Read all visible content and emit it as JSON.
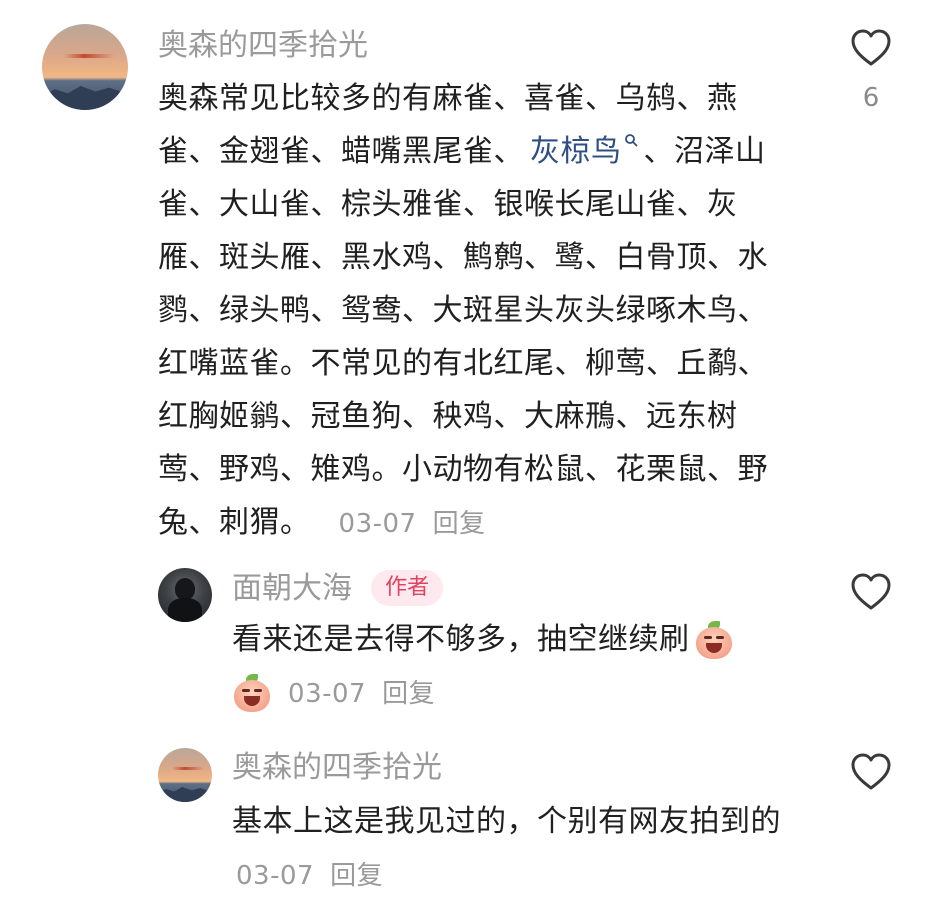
{
  "comments": [
    {
      "username": "奥森的四季拾光",
      "text_before": "奥森常见比较多的有麻雀、喜雀、乌鸫、燕雀、金翅雀、蜡嘴黑尾雀、",
      "link_text": "灰椋鸟",
      "text_after": "、沼泽山雀、大山雀、棕头雅雀、银喉长尾山雀、灰雁、斑头雁、黑水鸡、鹪鹩、鹭、白骨顶、水鹨、绿头鸭、鸳鸯、大斑星头灰头绿啄木鸟、红嘴蓝雀。不常见的有北红尾、柳莺、丘鹬、红胸姬鹟、冠鱼狗、秧鸡、大麻鳽、远东树莺、野鸡、雉鸡。小动物有松鼠、花栗鼠、野兔、刺猬。",
      "date": "03-07",
      "reply_label": "回复",
      "like_count": "6",
      "replies": [
        {
          "username": "面朝大海",
          "badge": "作者",
          "text": "看来还是去得不够多，抽空继续刷",
          "date": "03-07",
          "reply_label": "回复"
        },
        {
          "username": "奥森的四季拾光",
          "text": "基本上这是我见过的，个别有网友拍到的",
          "date": "03-07",
          "reply_label": "回复"
        }
      ]
    }
  ],
  "icons": {
    "like": "heart-outline-icon",
    "search_hint": "search-magnifier-icon",
    "emoji": "laughing-peach-emoji"
  },
  "colors": {
    "username": "#9a9a9a",
    "link": "#2e4f84",
    "badge_bg": "#fde9ee",
    "badge_text": "#e0435f"
  }
}
